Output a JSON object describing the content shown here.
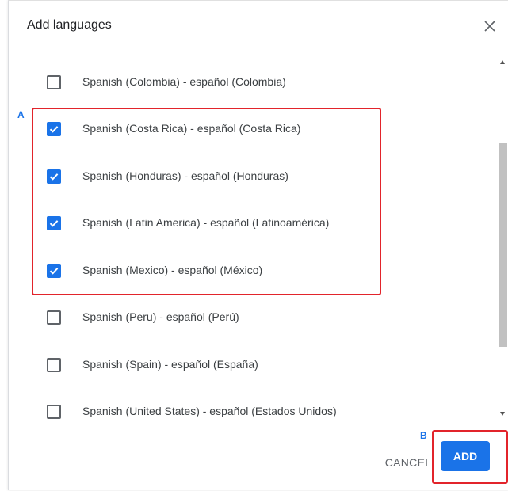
{
  "dialog": {
    "title": "Add languages",
    "close_icon": "close-icon"
  },
  "languages": [
    {
      "label": "Spanish (Colombia) - español (Colombia)",
      "checked": false
    },
    {
      "label": "Spanish (Costa Rica) - español (Costa Rica)",
      "checked": true
    },
    {
      "label": "Spanish (Honduras) - español (Honduras)",
      "checked": true
    },
    {
      "label": "Spanish (Latin America) - español (Latinoamérica)",
      "checked": true
    },
    {
      "label": "Spanish (Mexico) - español (México)",
      "checked": true
    },
    {
      "label": "Spanish (Peru) - español (Perú)",
      "checked": false
    },
    {
      "label": "Spanish (Spain) - español (España)",
      "checked": false
    },
    {
      "label": "Spanish (United States) - español (Estados Unidos)",
      "checked": false
    }
  ],
  "footer": {
    "cancel_label": "CANCEL",
    "add_label": "ADD"
  },
  "annotations": {
    "marker_a": "A",
    "marker_b": "B"
  },
  "colors": {
    "accent": "#1a73e8",
    "highlight": "#e2242b"
  }
}
